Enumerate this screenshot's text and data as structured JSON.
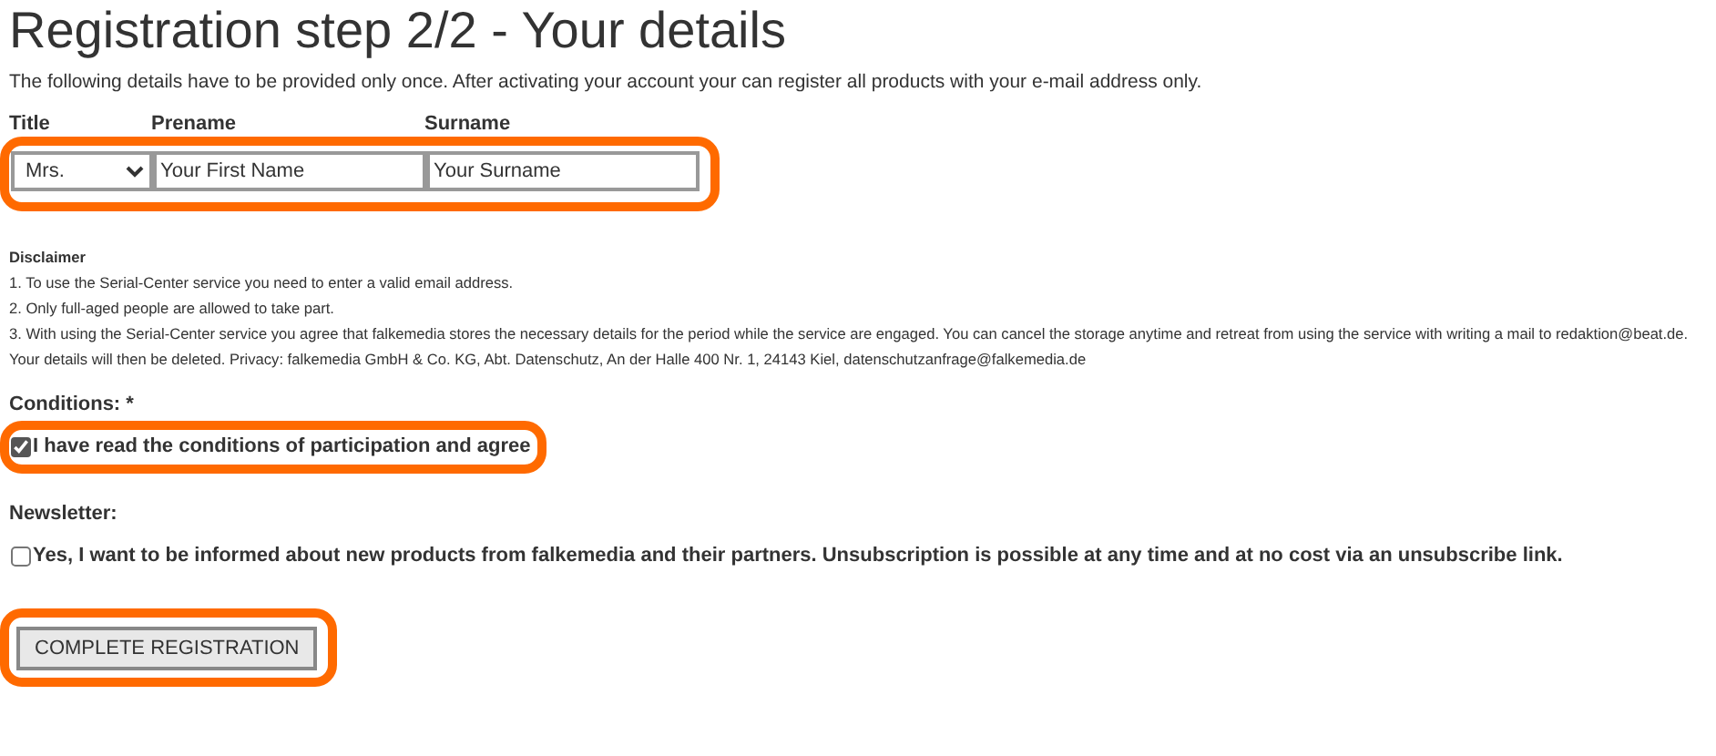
{
  "heading": "Registration step 2/2 - Your details",
  "intro": "The following details have to be provided only once. After activating your account your can register all products with your e-mail address only.",
  "fields": [
    {
      "kind": "select",
      "label": "Title",
      "value": "Mrs."
    },
    {
      "kind": "text",
      "label": "Prename",
      "value": "Your First Name"
    },
    {
      "kind": "text",
      "label": "Surname",
      "value": "Your Surname"
    }
  ],
  "fields_highlighted": true,
  "disclaimer": {
    "title": "Disclaimer",
    "lines": [
      "1. To use the Serial-Center service you need to enter a valid email address.",
      "2. Only full-aged people are allowed to take part.",
      "3. With using the Serial-Center service you agree that falkemedia stores the necessary details for the period while the service are engaged. You can cancel the storage anytime and retreat from using the service with writing a mail to redaktion@beat.de. Your details will then be deleted. Privacy: falkemedia GmbH & Co. KG, Abt. Datenschutz, An der Halle 400 Nr. 1, 24143 Kiel, datenschutzanfrage@falkemedia.de"
    ]
  },
  "options": [
    {
      "heading": "Conditions: *",
      "label": "I have read the conditions of participation and agree",
      "checked": true,
      "highlighted": true
    },
    {
      "heading": "Newsletter:",
      "label": "Yes, I want to be informed about new products from falkemedia and their partners. Unsubscription is possible at any time and at no cost via an unsubscribe link.",
      "checked": false,
      "highlighted": false
    }
  ],
  "submit": {
    "label": "COMPLETE REGISTRATION",
    "highlighted": true
  }
}
